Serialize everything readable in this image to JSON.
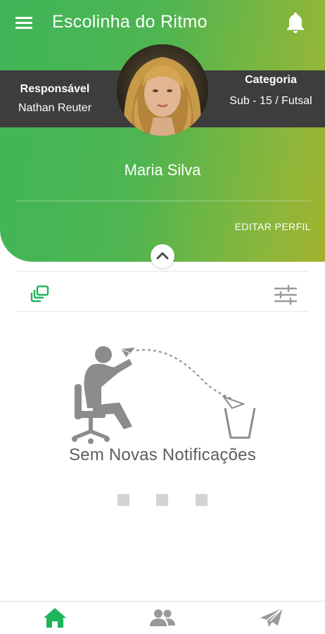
{
  "app": {
    "title": "Escolinha do Ritmo"
  },
  "profile": {
    "responsible_label": "Responsável",
    "responsible_name": "Nathan Reuter",
    "category_label": "Categoria",
    "category_value": "Sub - 15 / Futsal",
    "name": "Maria Silva",
    "edit_label": "EDITAR PERFIL"
  },
  "feed": {
    "empty_message": "Sem Novas Notificações"
  },
  "pagination": {
    "count": 3
  },
  "colors": {
    "header_start": "#3fb558",
    "header_end": "#a2b12e",
    "band": "#3d3d3d",
    "accent": "#1fb45a",
    "icon_gray": "#9a9a9a"
  },
  "icons": {
    "menu": "hamburger-icon",
    "bell": "bell-icon",
    "collapse": "chevron-up-icon",
    "stack": "stacked-cards-icon",
    "filter": "sliders-icon",
    "home": "home-icon",
    "group": "people-icon",
    "send": "send-icon"
  }
}
